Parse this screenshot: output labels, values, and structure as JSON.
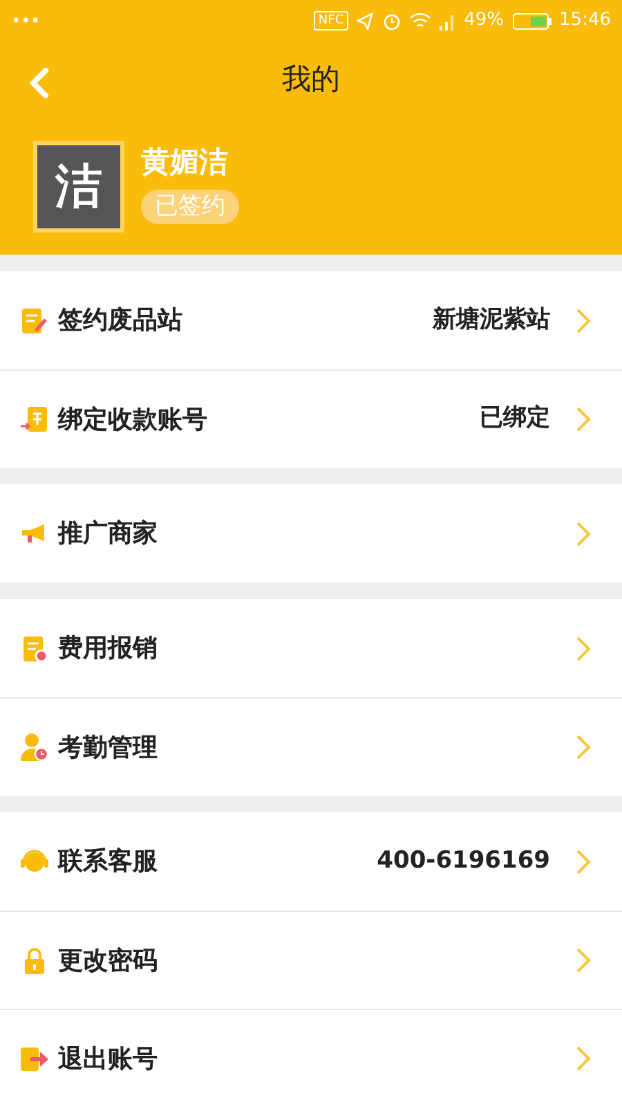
{
  "status_bar": {
    "dots": "•••",
    "nfc": "NFC",
    "battery": "49%",
    "time": "15:46"
  },
  "header": {
    "title": "我的"
  },
  "profile": {
    "avatar": "洁",
    "name": "黄媚洁",
    "badge": "已签约"
  },
  "groups": [
    {
      "items": [
        {
          "kind": "contract",
          "label": "签约废品站",
          "value": "新塘泥紫站"
        },
        {
          "kind": "account",
          "label": "绑定收款账号",
          "value": "已绑定"
        }
      ]
    },
    {
      "items": [
        {
          "kind": "megaphone",
          "label": "推广商家"
        }
      ]
    },
    {
      "items": [
        {
          "kind": "expense",
          "label": "费用报销"
        },
        {
          "kind": "attendance",
          "label": "考勤管理"
        }
      ]
    },
    {
      "items": [
        {
          "kind": "service",
          "label": "联系客服",
          "value": "400-6196169"
        },
        {
          "kind": "lock",
          "label": "更改密码"
        },
        {
          "kind": "logout",
          "label": "退出账号"
        }
      ]
    }
  ]
}
